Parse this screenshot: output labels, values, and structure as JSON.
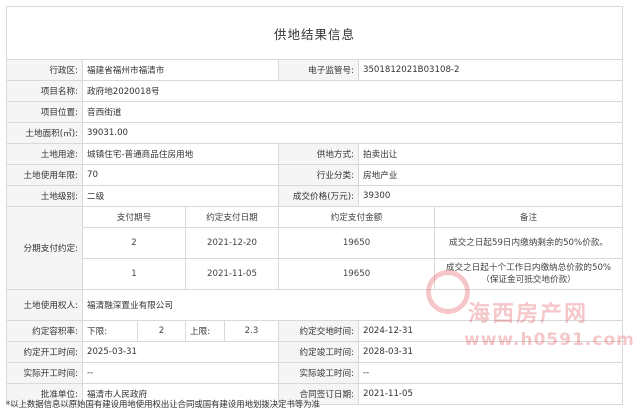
{
  "title": "供地结果信息",
  "fields": {
    "district_label": "行政区:",
    "district_value": "福建省福州市福清市",
    "eid_label": "电子监管号:",
    "eid_value": "3501812021B03108-2",
    "project_name_label": "项目名称:",
    "project_name_value": "政府地2020018号",
    "location_label": "项目位置:",
    "location_value": "音西街道",
    "area_label": "土地面积(㎡):",
    "area_value": "39031.00",
    "usage_label": "土地用途:",
    "usage_value": "城镇住宅-普通商品住房用地",
    "supply_label": "供地方式:",
    "supply_value": "拍卖出让",
    "years_label": "土地使用年限:",
    "years_value": "70",
    "industry_label": "行业分类:",
    "industry_value": "房地产业",
    "level_label": "土地级别:",
    "level_value": "二级",
    "price_label": "成交价格(万元):",
    "price_value": "39300"
  },
  "installments": {
    "label": "分期支付约定:",
    "headers": [
      "支付期号",
      "约定支付日期",
      "约定支付金额",
      "备注"
    ],
    "rows": [
      {
        "period": "2",
        "date": "2021-12-20",
        "amount": "19650",
        "note": "成交之日起59日内缴纳剩余的50%价款。"
      },
      {
        "period": "1",
        "date": "2021-11-05",
        "amount": "19650",
        "note": "成交之日起十个工作日内缴纳总价款的50%（保证金可抵交地价款）"
      }
    ]
  },
  "user": {
    "label": "土地使用权人:",
    "value": "福清融深置业有限公司"
  },
  "plot_ratio": {
    "label": "约定容积率:",
    "lower_label": "下限:",
    "lower_value": "2",
    "upper_label": "上限:",
    "upper_value": "2.3",
    "delivery_label": "约定交地时间:",
    "delivery_value": "2024-12-31"
  },
  "schedule": {
    "start_label": "约定开工时间:",
    "start_value": "2025-03-31",
    "finish_label": "约定竣工时间:",
    "finish_value": "2028-03-31",
    "actual_start_label": "实际开工时间:",
    "actual_start_value": "--",
    "actual_finish_label": "实际竣工时间:",
    "actual_finish_value": "--"
  },
  "approval": {
    "unit_label": "批准单位:",
    "unit_value": "福清市人民政府",
    "sign_label": "合同签订日期:",
    "sign_value": "2021-11-05"
  },
  "footnote": "*以上数据信息以原始国有建设用地使用权出让合同或国有建设用地划拨决定书等为准",
  "watermark": {
    "text": "海西房产网",
    "url": "www.h0591.com",
    "color": "#d8232a"
  }
}
